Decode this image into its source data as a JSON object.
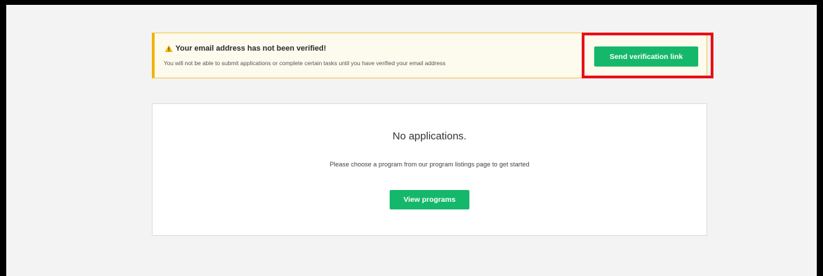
{
  "banner": {
    "title": "Your email address has not been verified!",
    "message": "You will not be able to submit applications or complete certain tasks until you have verified your email address",
    "action_label": "Send verification link",
    "icon": "warning-icon",
    "accent_color": "#f2b300"
  },
  "applications": {
    "empty_title": "No applications.",
    "empty_message": "Please choose a program from our program listings page to get started",
    "action_label": "View programs"
  },
  "colors": {
    "primary_button": "#15b86a",
    "highlight": "#e81016"
  }
}
